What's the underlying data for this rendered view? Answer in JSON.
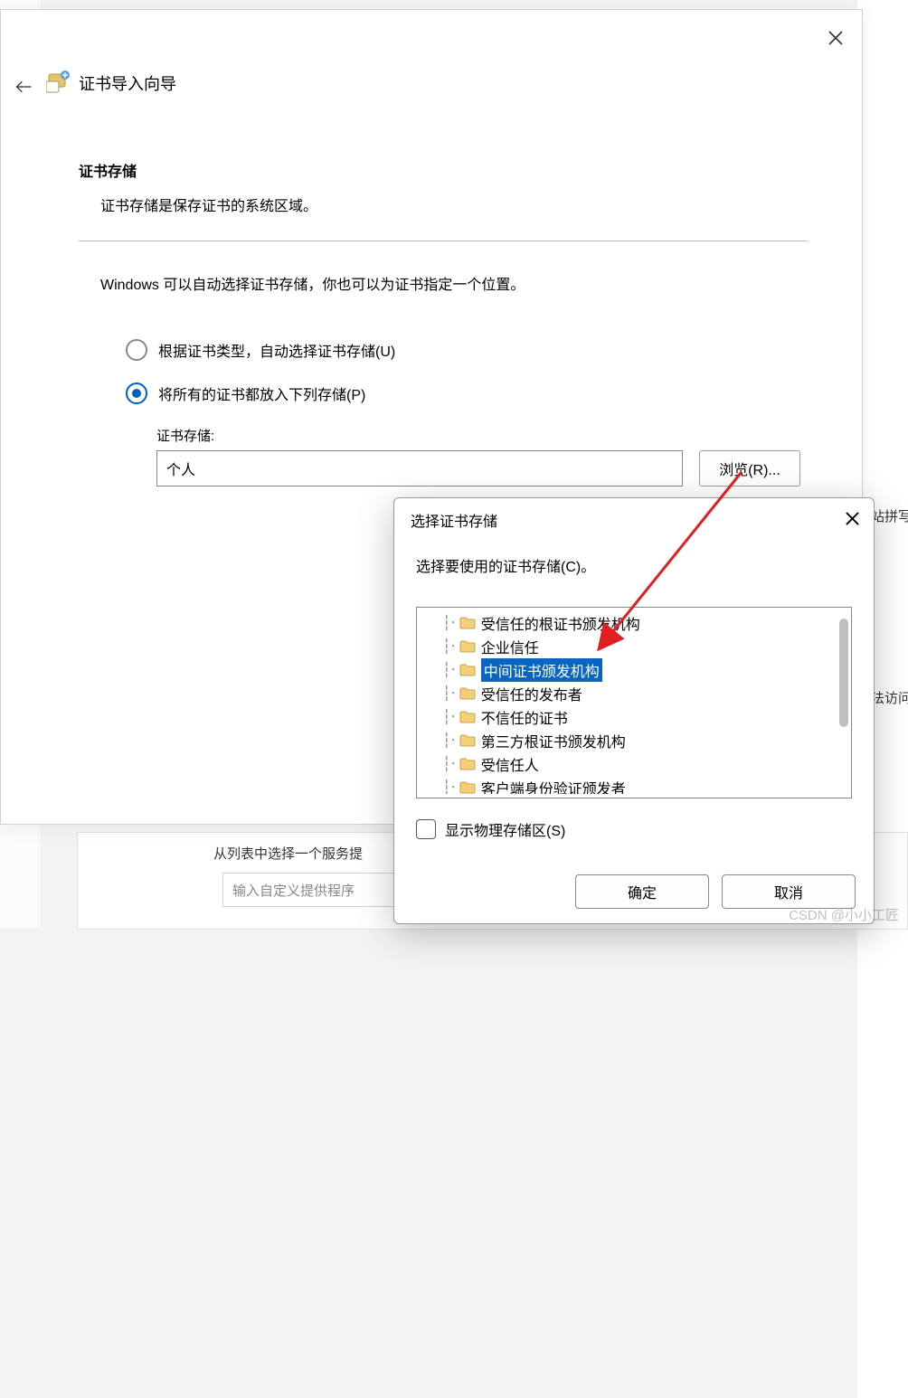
{
  "background": {
    "right_hint_1": "网站拼写",
    "right_hint_2": "无法访问",
    "bottom_label": "从列表中选择一个服务提",
    "bottom_placeholder": "输入自定义提供程序"
  },
  "wizard": {
    "title": "证书导入向导",
    "section_title": "证书存储",
    "section_desc": "证书存储是保存证书的系统区域。",
    "hint": "Windows 可以自动选择证书存储，你也可以为证书指定一个位置。",
    "radio_auto": "根据证书类型，自动选择证书存储(U)",
    "radio_manual": "将所有的证书都放入下列存储(P)",
    "radio_selected": "manual",
    "store_label": "证书存储:",
    "store_value": "个人",
    "browse_label": "浏览(R)..."
  },
  "popup": {
    "title": "选择证书存储",
    "instruction": "选择要使用的证书存储(C)。",
    "items": [
      "受信任的根证书颁发机构",
      "企业信任",
      "中间证书颁发机构",
      "受信任的发布者",
      "不信任的证书",
      "第三方根证书颁发机构",
      "受信任人",
      "客户端身份验证颁发者"
    ],
    "selected_index": 2,
    "show_physical_label": "显示物理存储区(S)",
    "ok_label": "确定",
    "cancel_label": "取消"
  },
  "watermark": "CSDN @小小工匠"
}
